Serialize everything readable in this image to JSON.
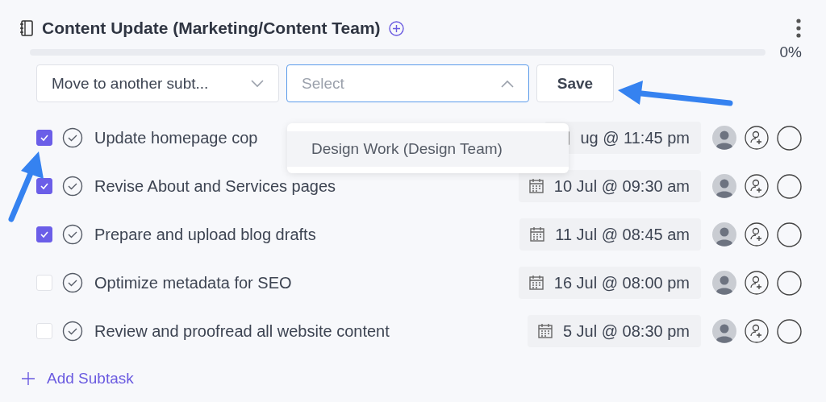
{
  "header": {
    "title": "Content Update (Marketing/Content Team)",
    "progress": {
      "level": 0,
      "reading": "0%"
    }
  },
  "move_bar": {
    "move_select": {
      "value": "Move to another subt..."
    },
    "target_select": {
      "placeholder": "Select",
      "expanded": true
    },
    "save_button": "Save"
  },
  "dropdown": {
    "options": [
      {
        "label": "Design Work (Design Team)"
      }
    ]
  },
  "subtasks": [
    {
      "title": "Update homepage cop",
      "checked": true,
      "due": "ug @ 11:45 pm"
    },
    {
      "title": "Revise About and Services pages",
      "checked": true,
      "due": "10 Jul @ 09:30 am"
    },
    {
      "title": "Prepare and upload blog drafts",
      "checked": true,
      "due": "11 Jul @ 08:45 am"
    },
    {
      "title": "Optimize metadata for SEO",
      "checked": false,
      "due": "16 Jul @ 08:00 pm"
    },
    {
      "title": "Review and proofread all website content",
      "checked": false,
      "due": "5 Jul @ 08:30 pm"
    }
  ],
  "add_subtask": "Add Subtask"
}
